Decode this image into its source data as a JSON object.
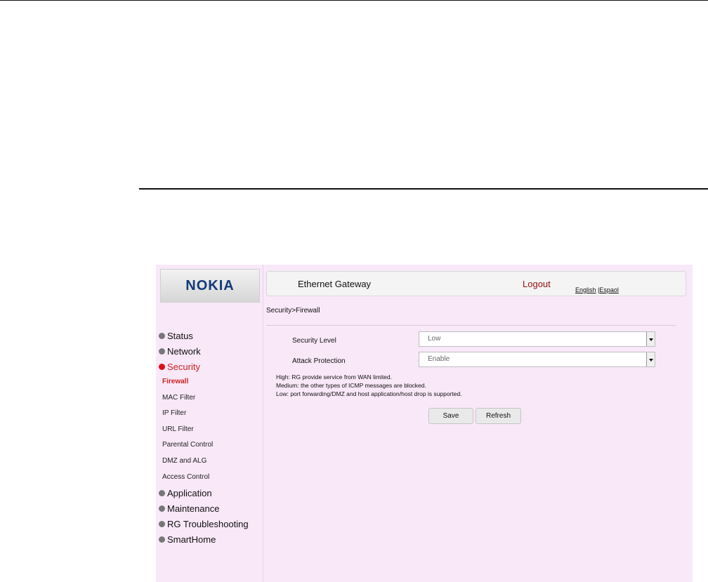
{
  "brand": {
    "logo_text": "NOKIA"
  },
  "header": {
    "title": "Ethernet Gateway",
    "logout": "Logout",
    "lang_english": "English",
    "lang_sep": " |",
    "lang_espanol": "Espaol"
  },
  "breadcrumb": "Security>Firewall",
  "sidebar": {
    "groups": [
      {
        "label": "Status",
        "expanded": false
      },
      {
        "label": "Network",
        "expanded": false
      },
      {
        "label": "Security",
        "expanded": true,
        "items": [
          "Firewall",
          "MAC Filter",
          "IP Filter",
          "URL Filter",
          "Parental Control",
          "DMZ and ALG",
          "Access Control"
        ],
        "active_item": "Firewall"
      },
      {
        "label": "Application",
        "expanded": false
      },
      {
        "label": "Maintenance",
        "expanded": false
      },
      {
        "label": "RG Troubleshooting",
        "expanded": false
      },
      {
        "label": "SmartHome",
        "expanded": false
      }
    ]
  },
  "form": {
    "security_level": {
      "label": "Security Level",
      "value": "Low"
    },
    "attack_protection": {
      "label": "Attack Protection",
      "value": "Enable"
    }
  },
  "notes": [
    "High: RG provide service from WAN limited.",
    "Medium: the other types of ICMP messages are blocked.",
    "Low: port forwarding/DMZ and host application/host drop is supported."
  ],
  "buttons": {
    "save": "Save",
    "refresh": "Refresh"
  },
  "colors": {
    "frame_bg": "#f8e8f8",
    "active_red": "#cc1f1f",
    "logo_blue": "#13397a",
    "logout_red": "#9a1010"
  }
}
